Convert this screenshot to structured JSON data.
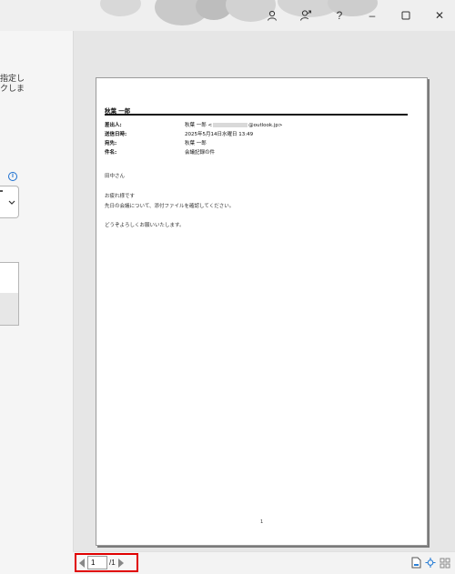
{
  "window": {
    "icons": [
      "account-icon",
      "share-profile-icon"
    ],
    "help_label": "?",
    "minimize_label": "–",
    "close_label": "✕"
  },
  "left_panel": {
    "text": "指定し\nクしま",
    "info_label": "i"
  },
  "email": {
    "sender_name": "秋葉 一郎",
    "headers": [
      {
        "label": "差出人:",
        "value_prefix": "秋葉 一郎 <",
        "value_suffix": "@outlook.jp>"
      },
      {
        "label": "送信日時:",
        "value": "2025年5月14日水曜日 13:49"
      },
      {
        "label": "宛先:",
        "value": "秋葉 一郎"
      },
      {
        "label": "件名:",
        "value": "会議記録の件"
      }
    ],
    "body": [
      "田中さん",
      "",
      "お疲れ様です",
      "先日の会議について、添付ファイルを確認してください。",
      "",
      "どうぞよろしくお願いいたします。"
    ],
    "page_number": "1"
  },
  "pager": {
    "current_page": "1",
    "total_pages": "/1"
  },
  "accent_color": "#e00000"
}
